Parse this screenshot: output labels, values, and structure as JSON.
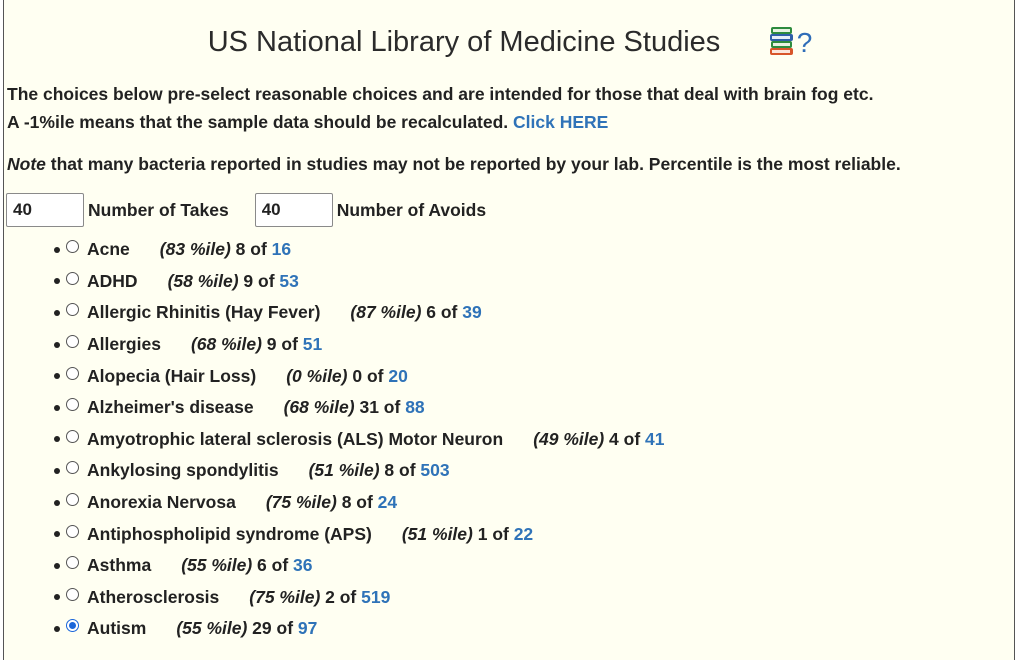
{
  "header": {
    "title": "US National Library of Medicine Studies",
    "help_mark": "?"
  },
  "info": {
    "line1": "The choices below pre-select reasonable choices and are intended for those that deal with brain fog etc.",
    "line2_text": "A -1%ile means that the sample data should be recalculated.",
    "line2_link": "Click HERE",
    "note_em": "Note",
    "note_rest": " that many bacteria reported in studies may not be reported by your lab. Percentile is the most reliable."
  },
  "controls": {
    "takes_value": "40",
    "takes_label": "Number of Takes",
    "avoids_value": "40",
    "avoids_label": "Number of Avoids"
  },
  "conditions": [
    {
      "name": "Acne",
      "pct": "83",
      "count": "8",
      "total": "16",
      "selected": false
    },
    {
      "name": "ADHD",
      "pct": "58",
      "count": "9",
      "total": "53",
      "selected": false
    },
    {
      "name": "Allergic Rhinitis (Hay Fever)",
      "pct": "87",
      "count": "6",
      "total": "39",
      "selected": false
    },
    {
      "name": "Allergies",
      "pct": "68",
      "count": "9",
      "total": "51",
      "selected": false
    },
    {
      "name": "Alopecia (Hair Loss)",
      "pct": "0",
      "count": "0",
      "total": "20",
      "selected": false
    },
    {
      "name": "Alzheimer's disease",
      "pct": "68",
      "count": "31",
      "total": "88",
      "selected": false
    },
    {
      "name": "Amyotrophic lateral sclerosis (ALS) Motor Neuron",
      "pct": "49",
      "count": "4",
      "total": "41",
      "selected": false
    },
    {
      "name": "Ankylosing spondylitis",
      "pct": "51",
      "count": "8",
      "total": "503",
      "selected": false
    },
    {
      "name": "Anorexia Nervosa",
      "pct": "75",
      "count": "8",
      "total": "24",
      "selected": false
    },
    {
      "name": "Antiphospholipid syndrome (APS)",
      "pct": "51",
      "count": "1",
      "total": "22",
      "selected": false
    },
    {
      "name": "Asthma",
      "pct": "55",
      "count": "6",
      "total": "36",
      "selected": false
    },
    {
      "name": "Atherosclerosis",
      "pct": "75",
      "count": "2",
      "total": "519",
      "selected": false
    },
    {
      "name": "Autism",
      "pct": "55",
      "count": "29",
      "total": "97",
      "selected": true
    }
  ],
  "labels": {
    "pct_suffix": " %ile",
    "of_word": "of"
  }
}
